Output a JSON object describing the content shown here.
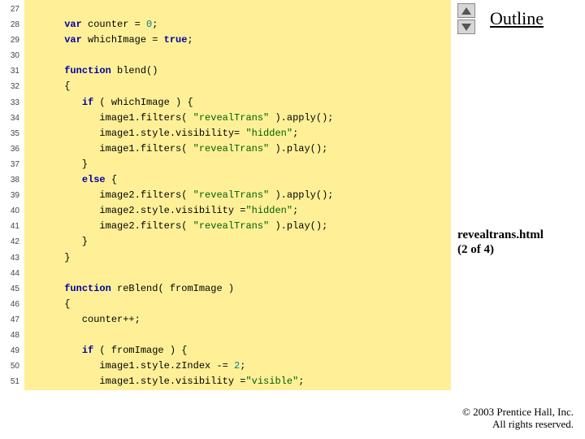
{
  "gutter_start": 27,
  "gutter_end": 51,
  "code_lines": [
    [
      [
        "   ",
        ""
      ]
    ],
    [
      [
        "      ",
        ""
      ],
      [
        "var",
        "kw"
      ],
      [
        " counter = ",
        ""
      ],
      [
        "0",
        "num"
      ],
      [
        ";",
        ""
      ]
    ],
    [
      [
        "      ",
        ""
      ],
      [
        "var",
        "kw"
      ],
      [
        " whichImage = ",
        ""
      ],
      [
        "true",
        "bool"
      ],
      [
        ";",
        ""
      ]
    ],
    [
      [
        "   ",
        ""
      ]
    ],
    [
      [
        "      ",
        ""
      ],
      [
        "function",
        "kw"
      ],
      [
        " blend()",
        ""
      ]
    ],
    [
      [
        "      {",
        ""
      ]
    ],
    [
      [
        "         ",
        ""
      ],
      [
        "if",
        "kw"
      ],
      [
        " ( whichImage ) {",
        ""
      ]
    ],
    [
      [
        "            image1.filters( ",
        ""
      ],
      [
        "\"revealTrans\"",
        "str"
      ],
      [
        " ).apply();",
        ""
      ]
    ],
    [
      [
        "            image1.style.visibility= ",
        ""
      ],
      [
        "\"hidden\"",
        "str"
      ],
      [
        ";",
        ""
      ]
    ],
    [
      [
        "            image1.filters( ",
        ""
      ],
      [
        "\"revealTrans\"",
        "str"
      ],
      [
        " ).play();",
        ""
      ]
    ],
    [
      [
        "         }",
        ""
      ]
    ],
    [
      [
        "         ",
        ""
      ],
      [
        "else",
        "kw"
      ],
      [
        " {",
        ""
      ]
    ],
    [
      [
        "            image2.filters( ",
        ""
      ],
      [
        "\"revealTrans\"",
        "str"
      ],
      [
        " ).apply();",
        ""
      ]
    ],
    [
      [
        "            image2.style.visibility =",
        ""
      ],
      [
        "\"hidden\"",
        "str"
      ],
      [
        ";",
        ""
      ]
    ],
    [
      [
        "            image2.filters( ",
        ""
      ],
      [
        "\"revealTrans\"",
        "str"
      ],
      [
        " ).play();",
        ""
      ]
    ],
    [
      [
        "         }",
        ""
      ]
    ],
    [
      [
        "      }",
        ""
      ]
    ],
    [
      [
        "   ",
        ""
      ]
    ],
    [
      [
        "      ",
        ""
      ],
      [
        "function",
        "kw"
      ],
      [
        " reBlend( fromImage )",
        ""
      ]
    ],
    [
      [
        "      {",
        ""
      ]
    ],
    [
      [
        "         counter++;",
        ""
      ]
    ],
    [
      [
        "   ",
        ""
      ]
    ],
    [
      [
        "         ",
        ""
      ],
      [
        "if",
        "kw"
      ],
      [
        " ( fromImage ) {",
        ""
      ]
    ],
    [
      [
        "            image1.style.zIndex -= ",
        ""
      ],
      [
        "2",
        "num"
      ],
      [
        ";",
        ""
      ]
    ],
    [
      [
        "            image1.style.visibility =",
        ""
      ],
      [
        "\"visible\"",
        "str"
      ],
      [
        ";",
        ""
      ]
    ]
  ],
  "side": {
    "outline": "Outline",
    "caption_title": "revealtrans.html",
    "caption_sub": "(2 of 4)"
  },
  "footer": {
    "line1": "© 2003 Prentice Hall, Inc.",
    "line2": "All rights reserved."
  }
}
